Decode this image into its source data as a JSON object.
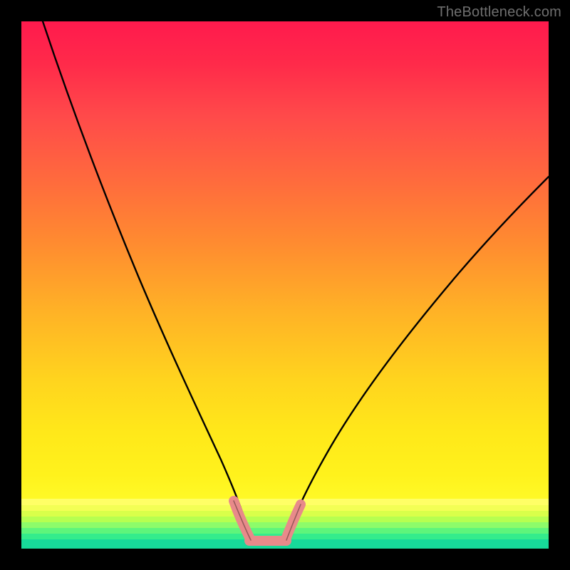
{
  "watermark": "TheBottleneck.com",
  "colors": {
    "frame": "#000000",
    "curve_black": "#000000",
    "pink_accent": "#e88a8a",
    "gradient_top": "#ff1a4d",
    "gradient_mid": "#ffd41e",
    "gradient_low": "#fffa28",
    "band_green1": "#8dfc6a",
    "band_green2": "#4cf57a",
    "band_green3": "#1fe88d",
    "band_green4": "#17d99a"
  },
  "chart_data": {
    "type": "line",
    "title": "",
    "xlabel": "",
    "ylabel": "",
    "xlim": [
      0,
      100
    ],
    "ylim": [
      0,
      100
    ],
    "series": [
      {
        "name": "left-curve",
        "x": [
          4,
          8,
          12,
          16,
          20,
          24,
          28,
          32,
          35,
          38,
          40,
          42,
          43
        ],
        "y": [
          100,
          88,
          76,
          65,
          54,
          44,
          34,
          25,
          17,
          10,
          6,
          3,
          1
        ]
      },
      {
        "name": "right-curve",
        "x": [
          50,
          52,
          55,
          58,
          62,
          67,
          73,
          80,
          88,
          96,
          100
        ],
        "y": [
          1,
          3,
          7,
          12,
          18,
          25,
          33,
          42,
          52,
          62,
          67
        ]
      },
      {
        "name": "pink-floor-zone",
        "x": [
          40,
          41,
          42,
          43,
          45,
          48,
          50,
          51,
          52
        ],
        "y": [
          8,
          5,
          3,
          1,
          1,
          1,
          1,
          3,
          6
        ]
      }
    ],
    "annotations": [
      {
        "text": "TheBottleneck.com",
        "position": "top-right"
      }
    ]
  }
}
